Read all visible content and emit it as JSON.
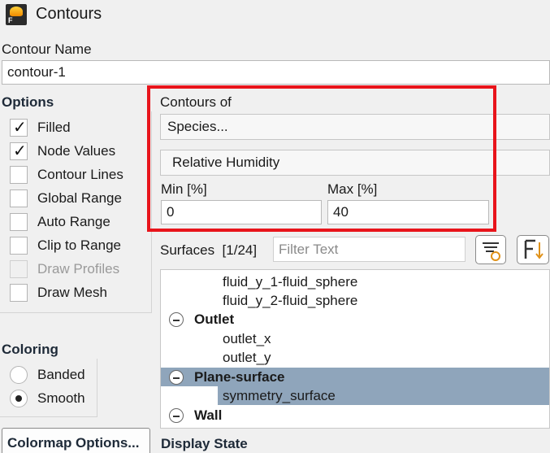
{
  "window": {
    "title": "Contours",
    "icon": "fluent-app-icon"
  },
  "contour_name": {
    "label": "Contour Name",
    "value": "contour-1"
  },
  "options": {
    "heading": "Options",
    "items": [
      {
        "label": "Filled",
        "checked": true,
        "disabled": false
      },
      {
        "label": "Node Values",
        "checked": true,
        "disabled": false
      },
      {
        "label": "Contour Lines",
        "checked": false,
        "disabled": false
      },
      {
        "label": "Global Range",
        "checked": false,
        "disabled": false
      },
      {
        "label": "Auto Range",
        "checked": false,
        "disabled": false
      },
      {
        "label": "Clip to Range",
        "checked": false,
        "disabled": false
      },
      {
        "label": "Draw Profiles",
        "checked": false,
        "disabled": true
      },
      {
        "label": "Draw Mesh",
        "checked": false,
        "disabled": false
      }
    ]
  },
  "contours_of": {
    "label": "Contours of",
    "category": "Species...",
    "quantity": "Relative Humidity",
    "min_label": "Min [%]",
    "min_value": "0",
    "max_label": "Max [%]",
    "max_value": "40"
  },
  "surfaces": {
    "label": "Surfaces",
    "count": "[1/24]",
    "filter_placeholder": "Filter Text",
    "tree": [
      {
        "label": "fluid_y_1-fluid_sphere",
        "type": "leaf"
      },
      {
        "label": "fluid_y_2-fluid_sphere",
        "type": "leaf"
      },
      {
        "label": "Outlet",
        "type": "group"
      },
      {
        "label": "outlet_x",
        "type": "leaf"
      },
      {
        "label": "outlet_y",
        "type": "leaf"
      },
      {
        "label": "Plane-surface",
        "type": "group",
        "selected": true
      },
      {
        "label": "symmetry_surface",
        "type": "leaf",
        "selected": true
      },
      {
        "label": "Wall",
        "type": "group"
      }
    ]
  },
  "coloring": {
    "heading": "Coloring",
    "options": [
      {
        "label": "Banded",
        "selected": false
      },
      {
        "label": "Smooth",
        "selected": true
      }
    ]
  },
  "colormap_button": "Colormap Options...",
  "display_state": "Display State",
  "colors": {
    "highlight": "#e8141b",
    "selection": "#8fa5bb"
  }
}
